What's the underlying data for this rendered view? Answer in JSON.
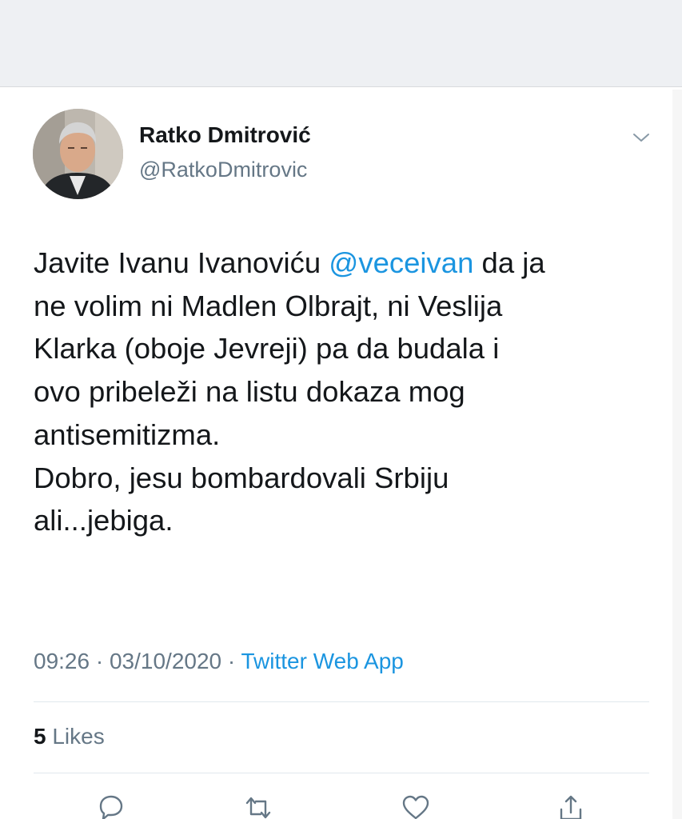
{
  "author": {
    "display_name": "Ratko Dmitrović",
    "handle": "@RatkoDmitrovic"
  },
  "tweet": {
    "lines": [
      {
        "before": "Javite Ivanu Ivanoviću ",
        "mention": "@veceivan",
        "after": " da ja"
      },
      {
        "text": "ne volim ni Madlen Olbrajt, ni Veslija"
      },
      {
        "text": "Klarka (oboje Jevreji) pa da budala i"
      },
      {
        "text": "ovo pribeleži na listu dokaza mog"
      },
      {
        "text": "antisemitizma."
      },
      {
        "text": "Dobro, jesu bombardovali Srbiju"
      },
      {
        "text": "ali...jebiga."
      }
    ]
  },
  "meta": {
    "time": "09:26",
    "separator": "·",
    "date": "03/10/2020",
    "source": "Twitter Web App"
  },
  "stats": {
    "likes_count": "5",
    "likes_label": "Likes"
  },
  "icons": {
    "chevron": "chevron-down-icon",
    "reply": "reply-icon",
    "retweet": "retweet-icon",
    "like": "heart-icon",
    "share": "share-icon"
  },
  "colors": {
    "link": "#1b95e0",
    "text": "#14171a",
    "secondary": "#657786"
  }
}
